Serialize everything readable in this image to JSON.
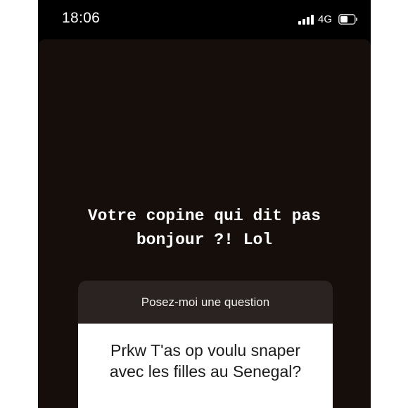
{
  "status_bar": {
    "time": "18:06",
    "network": "4G",
    "icons": [
      "signal-icon",
      "battery-icon"
    ]
  },
  "story": {
    "caption_line1": "Votre copine qui dit pas",
    "caption_line2": "bonjour ?! Lol"
  },
  "question_sticker": {
    "header": "Posez-moi une question",
    "answer_line1": "Prkw T'as op voulu snaper",
    "answer_line2": "avec les filles au Senegal?"
  },
  "colors": {
    "story_background": "#150e0b",
    "sticker_header": "#2a2321",
    "sticker_body": "#ffffff"
  }
}
